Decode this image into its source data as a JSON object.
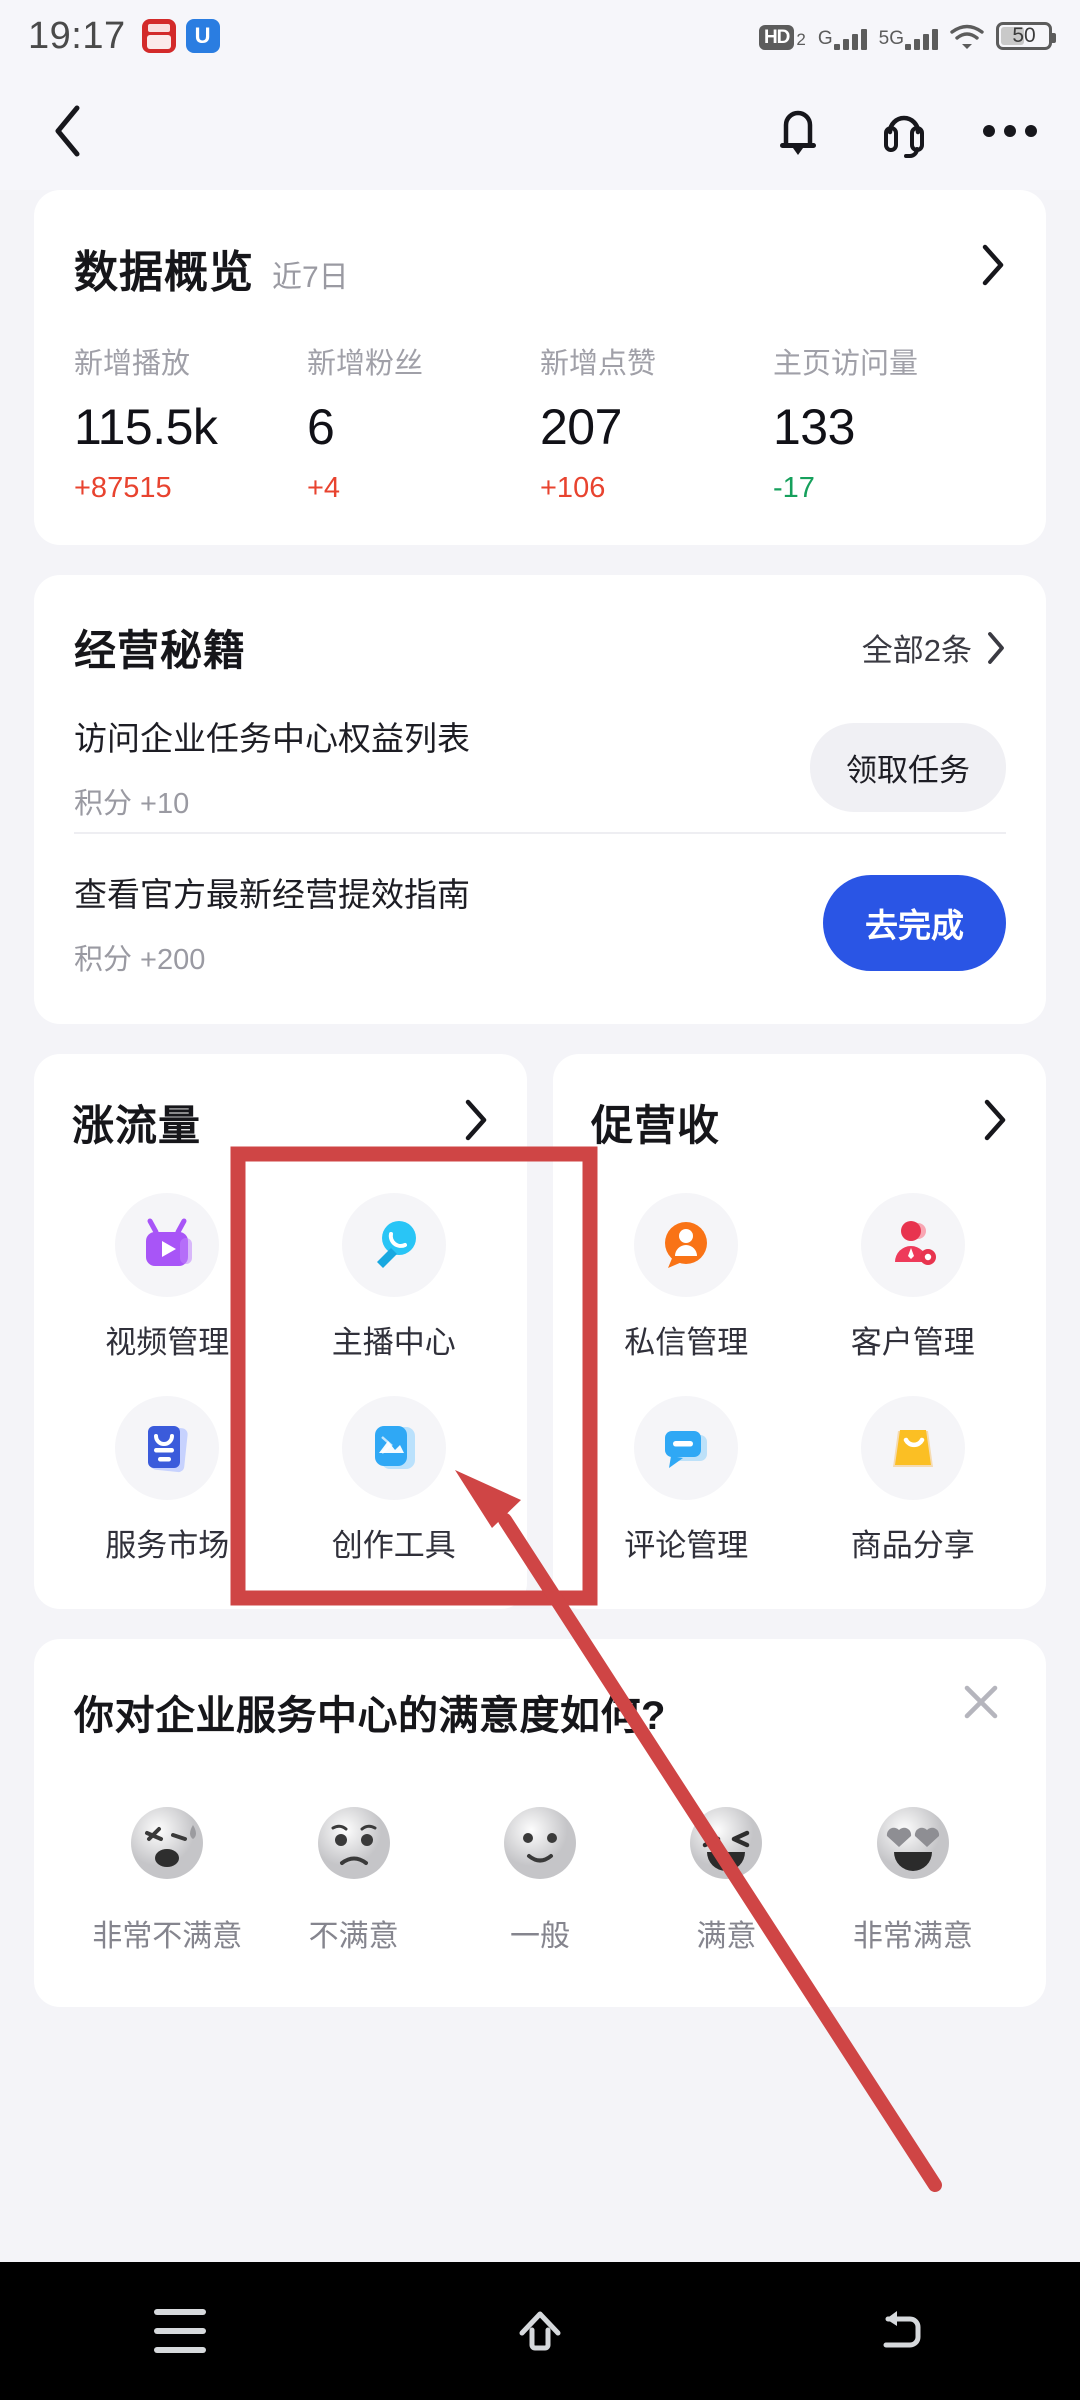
{
  "status_bar": {
    "time": "19:17",
    "app_icons": [
      "notification-app-red",
      "notification-app-blue"
    ],
    "hd_label": "HD",
    "hd_sub": "2",
    "signal_1_label": "G",
    "signal_2_label": "5G",
    "wifi": "wifi-icon",
    "battery_percent": "50"
  },
  "header": {
    "back": "back-chevron",
    "bell": "bell-icon",
    "headset": "headset-icon",
    "more": "more-dots-icon"
  },
  "overview": {
    "title": "数据概览",
    "subtitle": "近7日",
    "chevron": "chevron-right",
    "metrics": [
      {
        "label": "新增播放",
        "value": "115.5k",
        "delta": "+87515",
        "direction": "up"
      },
      {
        "label": "新增粉丝",
        "value": "6",
        "delta": "+4",
        "direction": "up"
      },
      {
        "label": "新增点赞",
        "value": "207",
        "delta": "+106",
        "direction": "up"
      },
      {
        "label": "主页访问量",
        "value": "133",
        "delta": "-17",
        "direction": "down"
      }
    ]
  },
  "tips": {
    "title": "经营秘籍",
    "all_label": "全部2条",
    "tasks": [
      {
        "name": "访问企业任务中心权益列表",
        "points": "积分 +10",
        "action": "领取任务",
        "style": "grey"
      },
      {
        "name": "查看官方最新经营提效指南",
        "points": "积分 +200",
        "action": "去完成",
        "style": "blue"
      }
    ]
  },
  "panels": [
    {
      "title": "涨流量",
      "tiles": [
        {
          "label": "视频管理",
          "icon": "video-manage-icon"
        },
        {
          "label": "主播中心",
          "icon": "anchor-center-icon"
        },
        {
          "label": "服务市场",
          "icon": "service-market-icon"
        },
        {
          "label": "创作工具",
          "icon": "creation-tools-icon"
        }
      ]
    },
    {
      "title": "促营收",
      "tiles": [
        {
          "label": "私信管理",
          "icon": "direct-message-icon"
        },
        {
          "label": "客户管理",
          "icon": "customer-manage-icon"
        },
        {
          "label": "评论管理",
          "icon": "comment-manage-icon"
        },
        {
          "label": "商品分享",
          "icon": "product-share-icon"
        }
      ]
    }
  ],
  "survey": {
    "question": "你对企业服务中心的满意度如何?",
    "close": "close-icon",
    "options": [
      {
        "label": "非常不满意",
        "icon": "face-very-unsatisfied"
      },
      {
        "label": "不满意",
        "icon": "face-unsatisfied"
      },
      {
        "label": "一般",
        "icon": "face-neutral"
      },
      {
        "label": "满意",
        "icon": "face-satisfied"
      },
      {
        "label": "非常满意",
        "icon": "face-very-satisfied"
      }
    ]
  },
  "android_nav": {
    "recents": "recents-icon",
    "home": "home-icon",
    "back": "back-icon"
  },
  "annotation": {
    "highlight_target": "主播中心",
    "color": "#cf4545"
  }
}
